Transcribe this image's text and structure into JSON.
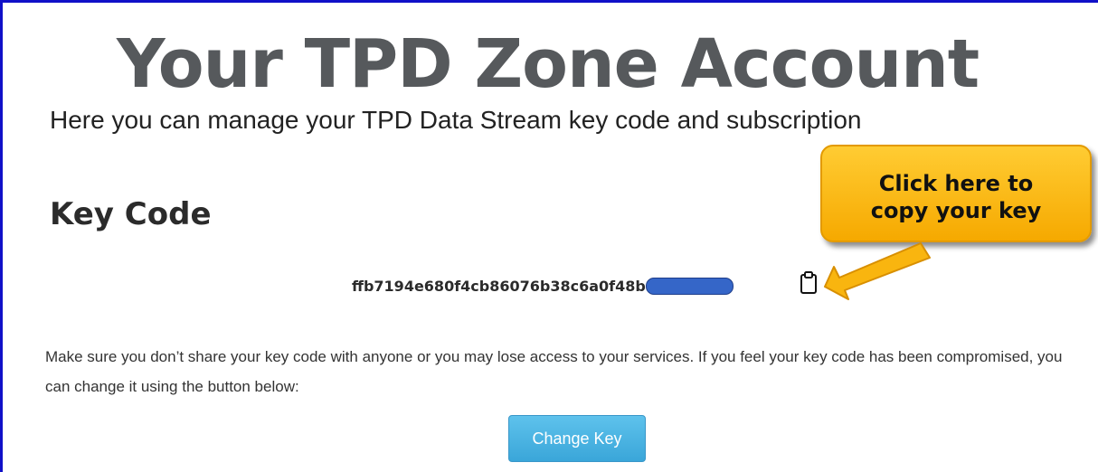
{
  "header": {
    "title": "Your TPD Zone Account",
    "subtitle": "Here you can manage your TPD Data Stream key code and subscription"
  },
  "key_section": {
    "heading": "Key Code",
    "key_code": "ffb7194e680f4cb86076b38c6a0f48b",
    "copy_icon": "clipboard-icon",
    "warning_text": "Make sure you don’t share your key code with anyone or you may lose access to your services. If you feel your key code has been compromised, you can change it using the button below:",
    "change_button_label": "Change Key"
  },
  "annotation": {
    "callout_line1": "Click here to",
    "callout_line2": "copy your key",
    "callout_color": "#f9b50f",
    "arrow_icon": "arrow-icon"
  },
  "colors": {
    "border": "#1010c8",
    "button": "#3aa6d9",
    "redaction": "#3566c8"
  }
}
